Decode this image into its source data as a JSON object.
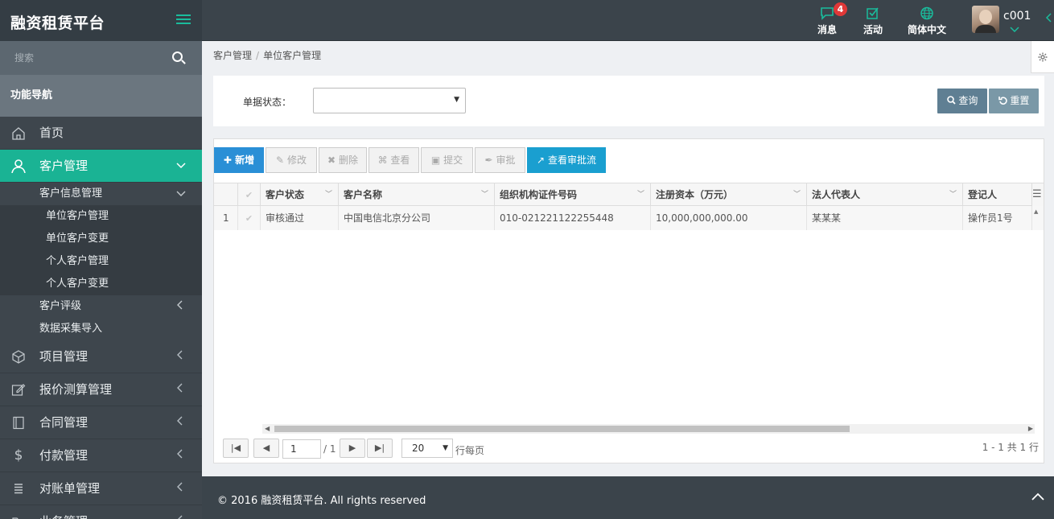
{
  "app": {
    "title": "融资租赁平台"
  },
  "topbar": {
    "messages": {
      "label": "消息",
      "badge": "4"
    },
    "activity": {
      "label": "活动"
    },
    "language": {
      "label": "简体中文"
    },
    "user": {
      "name": "c001"
    }
  },
  "sidebar": {
    "search_placeholder": "搜索",
    "nav_heading": "功能导航",
    "items": [
      {
        "label": "首页"
      },
      {
        "label": "客户管理"
      },
      {
        "label": "项目管理"
      },
      {
        "label": "报价测算管理"
      },
      {
        "label": "合同管理"
      },
      {
        "label": "付款管理"
      },
      {
        "label": "对账单管理"
      },
      {
        "label": "业务管理"
      }
    ],
    "sub": {
      "customer_info": "客户信息管理",
      "unit_manage": "单位客户管理",
      "unit_change": "单位客户变更",
      "personal_manage": "个人客户管理",
      "personal_change": "个人客户变更",
      "rating": "客户评级",
      "import": "数据采集导入"
    }
  },
  "breadcrumb": {
    "parent": "客户管理",
    "sep": "/",
    "current": "单位客户管理"
  },
  "filter": {
    "label": "单据状态：",
    "value": "",
    "query_label": "查询",
    "reset_label": "重置"
  },
  "toolbar": {
    "add": "新增",
    "edit": "修改",
    "delete": "删除",
    "view": "查看",
    "submit": "提交",
    "approve": "审批",
    "view_flow": "查看审批流"
  },
  "grid": {
    "columns": [
      "客户状态",
      "客户名称",
      "组织机构证件号码",
      "注册资本（万元）",
      "法人代表人",
      "登记人"
    ],
    "rows": [
      {
        "index": "1",
        "status": "审核通过",
        "name": "中国电信北京分公司",
        "org_code": "010-021221122255448",
        "capital": "10,000,000,000.00",
        "legal": "某某某",
        "registrar": "操作员1号"
      }
    ]
  },
  "pager": {
    "page": "1",
    "total_pages": "/ 1",
    "rows_per_page": "20",
    "rows_label": "行每页",
    "record_info": "1 - 1 共 1 行"
  },
  "footer": {
    "text": "© 2016 融资租赁平台. All rights reserved"
  },
  "colors": {
    "accent": "#1ab394",
    "topbar": "#3b444b",
    "primary_btn": "#2a8fd6"
  }
}
